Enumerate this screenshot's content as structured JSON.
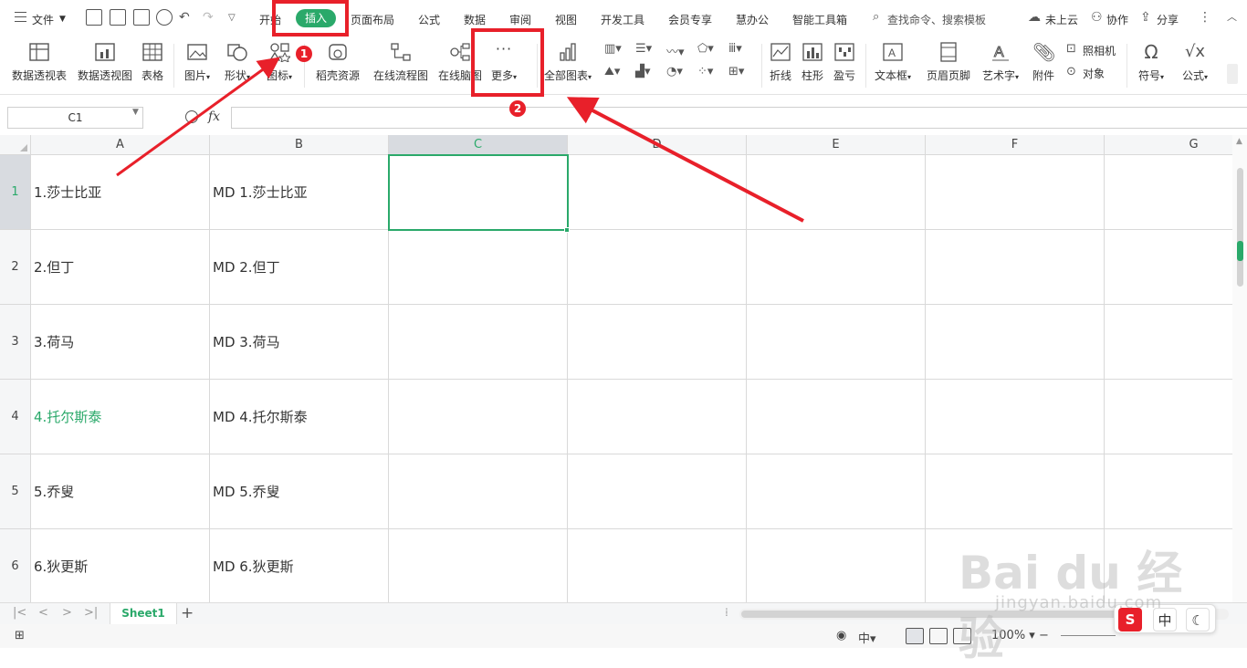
{
  "menubar": {
    "file_label": "文件",
    "tabs": [
      "开始",
      "插入",
      "页面布局",
      "公式",
      "数据",
      "审阅",
      "视图",
      "开发工具",
      "会员专享",
      "慧办公",
      "智能工具箱"
    ],
    "active_tab": "插入",
    "search_placeholder": "查找命令、搜索模板",
    "cloud_label": "未上云",
    "collab_label": "协作",
    "share_label": "分享"
  },
  "ribbon": {
    "pivot_table": "数据透视表",
    "pivot_chart": "数据透视图",
    "table": "表格",
    "picture": "图片",
    "shape": "形状",
    "icon": "图标",
    "daoke": "稻壳资源",
    "flowchart": "在线流程图",
    "mindmap": "在线脑图",
    "more": "更多",
    "all_charts": "全部图表",
    "line": "折线",
    "column": "柱形",
    "winloss": "盈亏",
    "textbox": "文本框",
    "header_footer": "页眉页脚",
    "wordart": "艺术字",
    "attachment": "附件",
    "camera": "照相机",
    "object": "对象",
    "symbol": "符号",
    "formula": "公式"
  },
  "formula_bar": {
    "namebox": "C1",
    "fx_symbol": "fx",
    "content": ""
  },
  "sheet": {
    "columns": [
      "A",
      "B",
      "C",
      "D",
      "E",
      "F",
      "G"
    ],
    "active_column": "C",
    "rows": [
      {
        "num": "1",
        "a": "1.莎士比亚",
        "b": "MD 1.莎士比亚"
      },
      {
        "num": "2",
        "a": "2.但丁",
        "b": "MD 2.但丁"
      },
      {
        "num": "3",
        "a": "3.荷马",
        "b": "MD 3.荷马"
      },
      {
        "num": "4",
        "a_prefix": "4.",
        "a_green": "托尔斯泰",
        "b": "MD 4.托尔斯泰"
      },
      {
        "num": "5",
        "a": "5.乔叟",
        "b": "MD 5.乔叟"
      },
      {
        "num": "6",
        "a": "6.狄更斯",
        "b": "MD 6.狄更斯"
      }
    ]
  },
  "sheetbar": {
    "tab_name": "Sheet1",
    "add_label": "+"
  },
  "statusbar": {
    "zoom": "100%"
  },
  "ime": {
    "mode": "中"
  },
  "annotations": {
    "badge1": "1",
    "badge2": "2"
  },
  "watermark": {
    "brand": "Bai du 经验",
    "url": "jingyan.baidu.com"
  },
  "colors": {
    "accent_green": "#2aa96a",
    "annotation_red": "#e8202a"
  }
}
